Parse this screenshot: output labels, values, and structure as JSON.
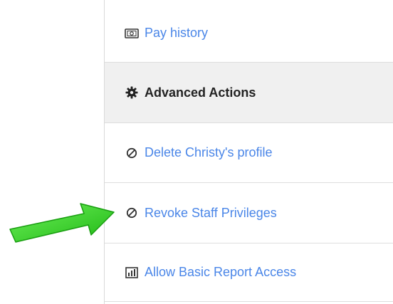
{
  "menu": {
    "pay_history_label": "Pay history",
    "advanced_actions_label": "Advanced Actions",
    "delete_profile_label": "Delete Christy's profile",
    "revoke_privileges_label": "Revoke Staff Privileges",
    "allow_report_label": "Allow Basic Report Access"
  },
  "icons": {
    "pay_history": "money-icon",
    "advanced_actions": "gear-icon",
    "delete_profile": "prohibited-icon",
    "revoke_privileges": "prohibited-icon",
    "allow_report": "bar-chart-icon"
  },
  "colors": {
    "link": "#4a86e8",
    "header_bg": "#f0f0f0",
    "arrow": "#2ecc1e"
  }
}
